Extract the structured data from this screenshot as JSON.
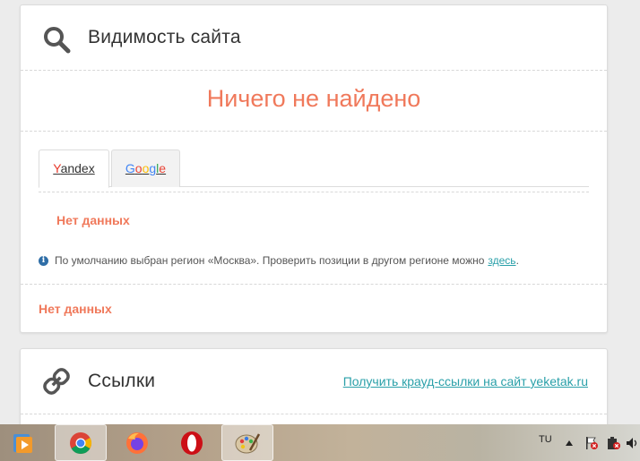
{
  "visibility": {
    "title": "Видимость сайта",
    "not_found": "Ничего не найдено",
    "tabs": [
      {
        "label_y": "Y",
        "label_rest": "andex"
      },
      {
        "letters": [
          "G",
          "o",
          "o",
          "g",
          "l",
          "e"
        ]
      }
    ],
    "no_data_tab": "Нет данных",
    "info_text": "По умолчанию выбран регион «Москва». Проверить позиции в другом регионе можно",
    "info_link": "здесь",
    "info_period": ".",
    "no_data_bottom": "Нет данных"
  },
  "links": {
    "title": "Ссылки",
    "crowd_link": "Получить крауд-ссылки на сайт yeketak.ru"
  },
  "taskbar": {
    "icons": [
      "media-player-icon",
      "chrome-icon",
      "firefox-icon",
      "opera-icon",
      "paint-icon"
    ],
    "lang": "TU",
    "colors": {
      "chrome_red": "#db4437",
      "chrome_green": "#0f9d58",
      "chrome_yellow": "#f4b400",
      "chrome_blue": "#4285f4",
      "opera_red": "#cc0f16",
      "firefox_orange": "#ff7139"
    }
  },
  "theme": {
    "accent": "#f0795b",
    "link": "#2aa0a9",
    "info_icon": "#2f6ea7"
  }
}
